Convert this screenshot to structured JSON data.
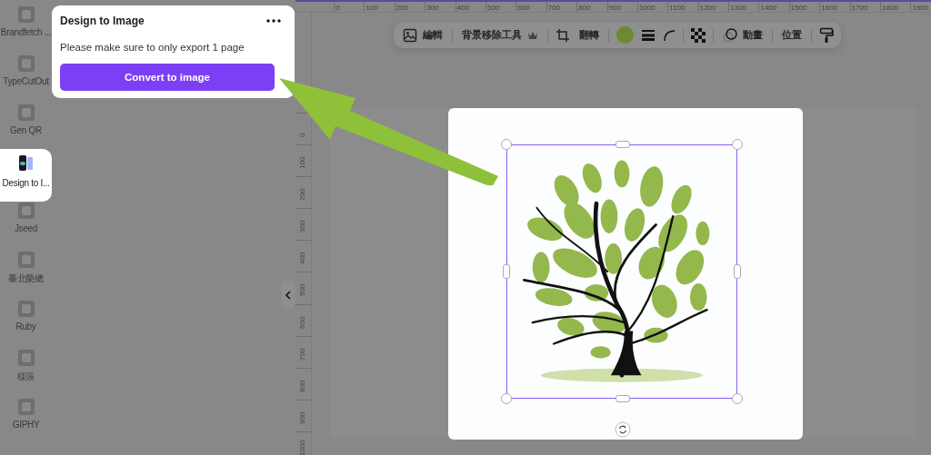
{
  "sidebar": {
    "items": [
      {
        "label": "Brandfetch ...",
        "selected": false
      },
      {
        "label": "TypeCutOut",
        "selected": false
      },
      {
        "label": "Gen QR",
        "selected": false
      },
      {
        "label": "Design to I...",
        "selected": true
      },
      {
        "label": "Jseed",
        "selected": false
      },
      {
        "label": "臺北榮總",
        "selected": false
      },
      {
        "label": "Ruby",
        "selected": false
      },
      {
        "label": "樣張",
        "selected": false
      },
      {
        "label": "GIPHY",
        "selected": false
      }
    ]
  },
  "popup": {
    "title": "Design to Image",
    "message": "Please make sure to only export 1 page",
    "button": "Convert to image"
  },
  "toolbar": {
    "edit": "編輯",
    "background_remover": "背景移除工具",
    "flip": "翻轉",
    "animate": "動畫",
    "position": "位置"
  },
  "rulers": {
    "horizontal": [
      "0",
      "100",
      "200",
      "300",
      "400",
      "500",
      "600",
      "700",
      "800",
      "900",
      "1000",
      "1100",
      "1200",
      "1300",
      "1400",
      "1500",
      "1600",
      "1700",
      "1800",
      "1900"
    ],
    "vertical": [
      "0",
      "100",
      "200",
      "300",
      "400",
      "500",
      "600",
      "700",
      "800",
      "900",
      "1000"
    ]
  }
}
